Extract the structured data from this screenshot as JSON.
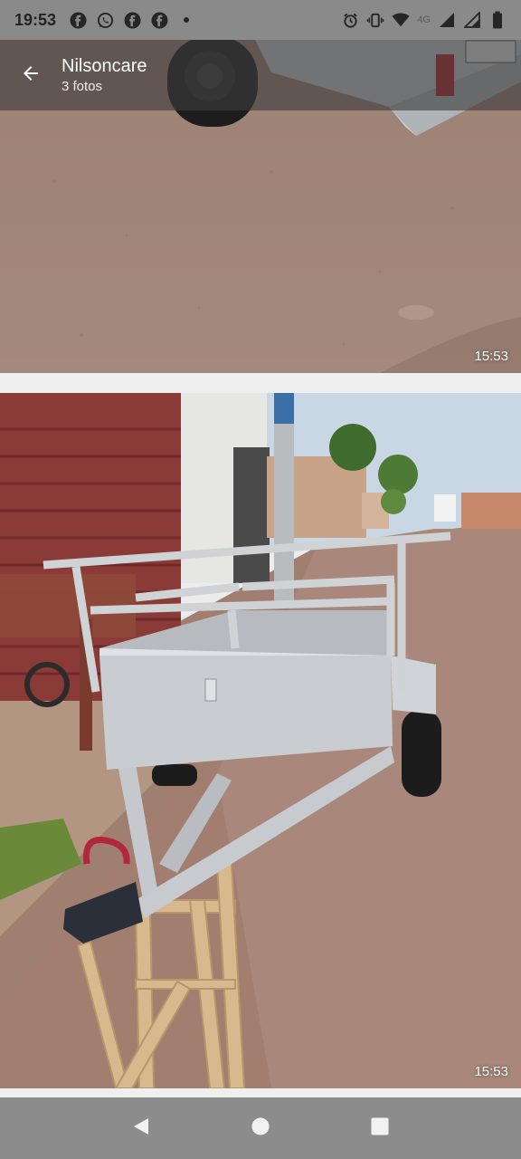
{
  "status_bar": {
    "time": "19:53",
    "notification_icons": [
      "facebook-icon",
      "whatsapp-icon",
      "facebook-icon",
      "facebook-icon",
      "dot-icon"
    ],
    "network_label": "4G",
    "system_icons": [
      "alarm-icon",
      "vibrate-icon",
      "wifi-icon",
      "signal-icon",
      "signal-icon",
      "battery-icon"
    ]
  },
  "app_bar": {
    "title": "Nilsoncare",
    "subtitle": "3 fotos"
  },
  "photos": [
    {
      "timestamp": "15:53"
    },
    {
      "timestamp": "15:53"
    }
  ],
  "nav_bar": {
    "buttons": [
      "back-triangle-icon",
      "home-circle-icon",
      "recents-square-icon"
    ]
  },
  "colors": {
    "status_bar_bg": "#8a8a8a",
    "app_bar_bg": "#3c3c3c",
    "nav_bar_bg": "#8c8c8c",
    "ground": "#a5877a",
    "trailer": "#c9cdd1"
  }
}
